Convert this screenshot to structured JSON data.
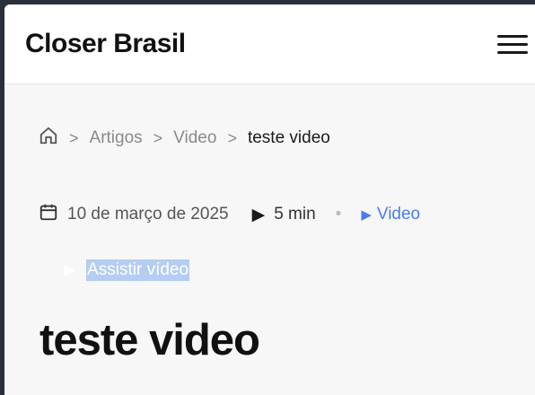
{
  "header": {
    "brand": "Closer Brasil",
    "menu_icon": "hamburger-menu-icon"
  },
  "breadcrumb": {
    "home_icon": "home-icon",
    "items": [
      "Artigos",
      "Video",
      "teste video"
    ]
  },
  "meta": {
    "date": "10 de março de 2025",
    "read_time": "5 min",
    "category": "Video"
  },
  "watch": {
    "label": "Assistir vídeo"
  },
  "article": {
    "title": "teste video"
  },
  "colors": {
    "accent": "#4b7bec",
    "highlight": "#b4cdf1"
  }
}
